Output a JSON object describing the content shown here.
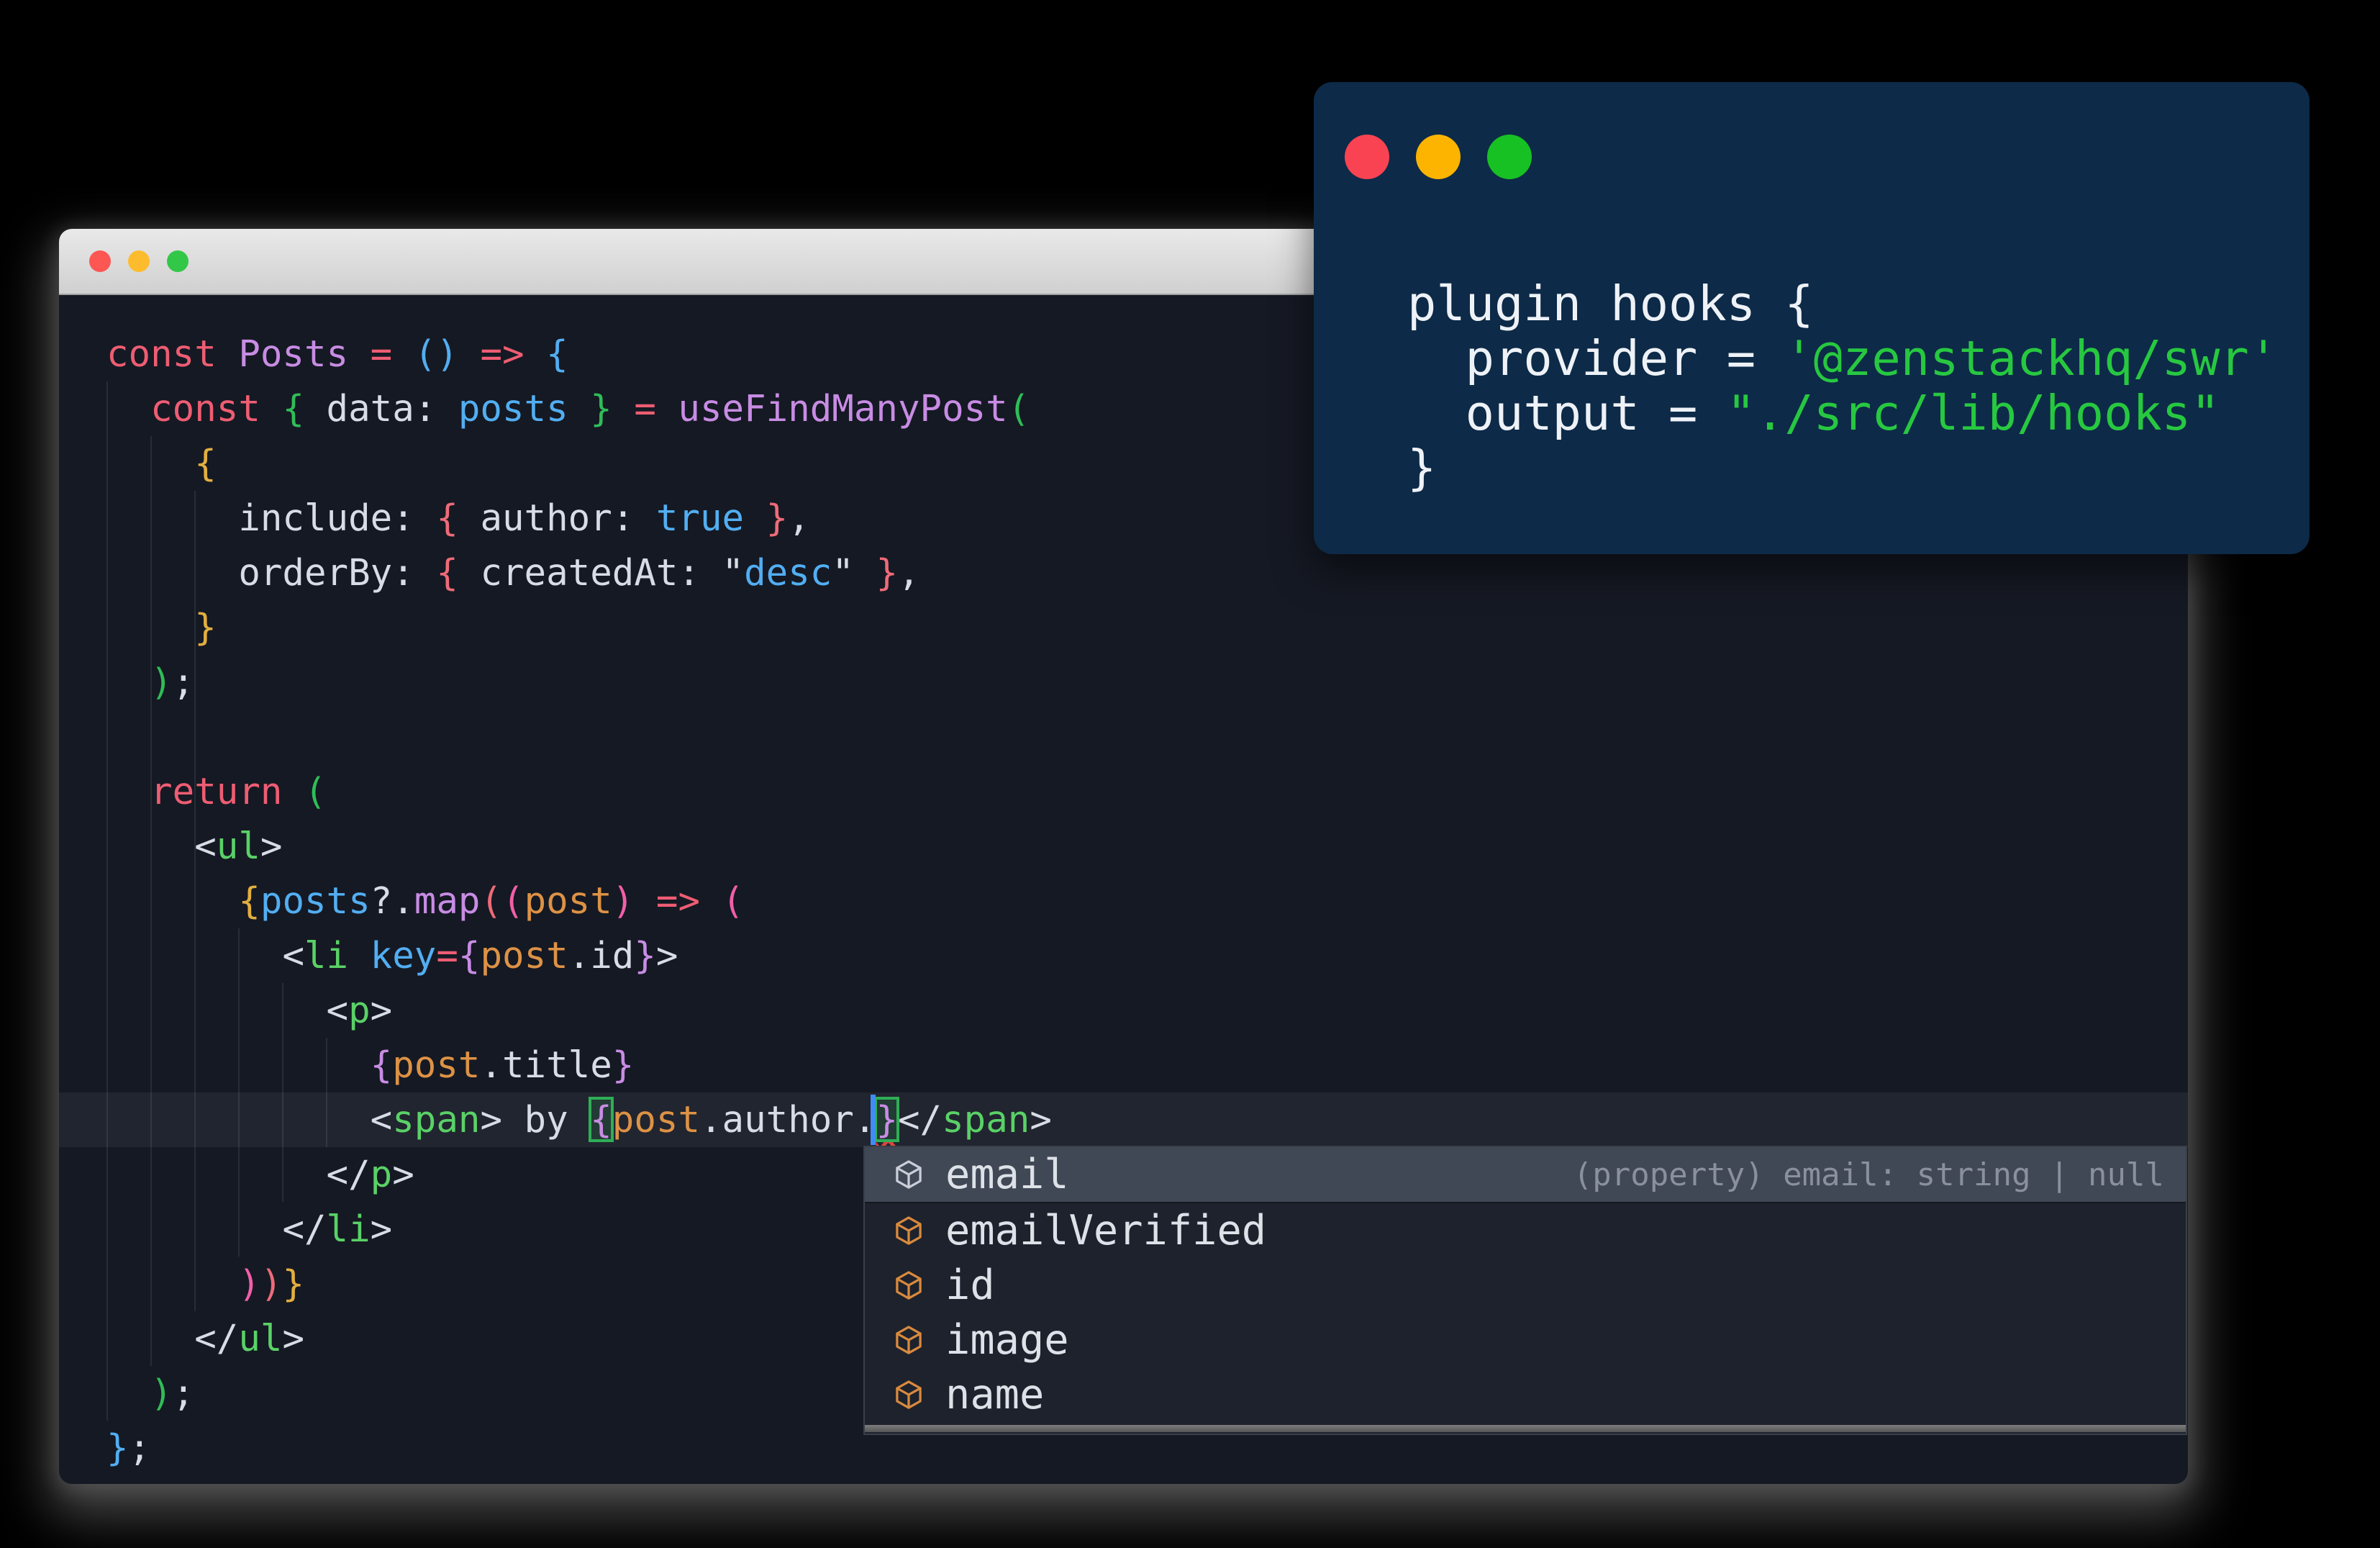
{
  "palette": {
    "fg": "#d7dce5",
    "red": "#ee5d73",
    "salmon": "#ee6b78",
    "purple": "#c88ce4",
    "blue": "#52aef2",
    "green_bracket": "#2fbd57",
    "green_tag": "#5ad167",
    "yellow": "#e2ae3f",
    "pink": "#f25fa9",
    "orange": "#dd9245",
    "editor_bg": "#151923",
    "overlay_bg": "#0d2a48",
    "overlay_fg": "#eef2f7",
    "overlay_green": "#27c840",
    "cursor_blue": "#3f8cf5",
    "squiggle_red": "#e0443f",
    "bracket_match_green": "#2fae56"
  },
  "main_window": {
    "traffic_lights": [
      {
        "name": "close",
        "color": "#fc5753"
      },
      {
        "name": "minimize",
        "color": "#fdbc2e"
      },
      {
        "name": "zoom",
        "color": "#33c748"
      }
    ]
  },
  "editor": {
    "current_line": 14,
    "lines": [
      [
        {
          "t": "const ",
          "c": "red"
        },
        {
          "t": "Posts ",
          "c": "purple"
        },
        {
          "t": "= ",
          "c": "red"
        },
        {
          "t": "()",
          "c": "blue"
        },
        {
          "t": " ",
          "c": "fg"
        },
        {
          "t": "=> ",
          "c": "red"
        },
        {
          "t": "{",
          "c": "blue"
        }
      ],
      [
        {
          "t": "  ",
          "c": "fg"
        },
        {
          "t": "const ",
          "c": "red"
        },
        {
          "t": "{ ",
          "c": "green_bracket"
        },
        {
          "t": "data: ",
          "c": "fg"
        },
        {
          "t": "posts ",
          "c": "blue"
        },
        {
          "t": "} ",
          "c": "green_bracket"
        },
        {
          "t": "= ",
          "c": "red"
        },
        {
          "t": "useFindManyPost",
          "c": "purple"
        },
        {
          "t": "(",
          "c": "green_bracket"
        }
      ],
      [
        {
          "t": "    ",
          "c": "fg"
        },
        {
          "t": "{",
          "c": "yellow"
        }
      ],
      [
        {
          "t": "      ",
          "c": "fg"
        },
        {
          "t": "include: ",
          "c": "fg"
        },
        {
          "t": "{ ",
          "c": "salmon"
        },
        {
          "t": "author: ",
          "c": "fg"
        },
        {
          "t": "true",
          "c": "blue"
        },
        {
          "t": " }",
          "c": "salmon"
        },
        {
          "t": ",",
          "c": "fg"
        }
      ],
      [
        {
          "t": "      ",
          "c": "fg"
        },
        {
          "t": "orderBy: ",
          "c": "fg"
        },
        {
          "t": "{ ",
          "c": "salmon"
        },
        {
          "t": "createdAt: ",
          "c": "fg"
        },
        {
          "t": "\"",
          "c": "fg"
        },
        {
          "t": "desc",
          "c": "blue"
        },
        {
          "t": "\"",
          "c": "fg"
        },
        {
          "t": " }",
          "c": "salmon"
        },
        {
          "t": ",",
          "c": "fg"
        }
      ],
      [
        {
          "t": "    ",
          "c": "fg"
        },
        {
          "t": "}",
          "c": "yellow"
        }
      ],
      [
        {
          "t": "  ",
          "c": "fg"
        },
        {
          "t": ")",
          "c": "green_bracket"
        },
        {
          "t": ";",
          "c": "fg"
        }
      ],
      [],
      [
        {
          "t": "  ",
          "c": "fg"
        },
        {
          "t": "return ",
          "c": "red"
        },
        {
          "t": "(",
          "c": "green_bracket"
        }
      ],
      [
        {
          "t": "    ",
          "c": "fg"
        },
        {
          "t": "<",
          "c": "fg"
        },
        {
          "t": "ul",
          "c": "green_tag"
        },
        {
          "t": ">",
          "c": "fg"
        }
      ],
      [
        {
          "t": "      ",
          "c": "fg"
        },
        {
          "t": "{",
          "c": "yellow"
        },
        {
          "t": "posts",
          "c": "blue"
        },
        {
          "t": "?.",
          "c": "fg"
        },
        {
          "t": "map",
          "c": "purple"
        },
        {
          "t": "(",
          "c": "salmon"
        },
        {
          "t": "(",
          "c": "pink"
        },
        {
          "t": "post",
          "c": "orange"
        },
        {
          "t": ")",
          "c": "pink"
        },
        {
          "t": " ",
          "c": "fg"
        },
        {
          "t": "=> ",
          "c": "red"
        },
        {
          "t": "(",
          "c": "pink"
        }
      ],
      [
        {
          "t": "        ",
          "c": "fg"
        },
        {
          "t": "<",
          "c": "fg"
        },
        {
          "t": "li",
          "c": "green_tag"
        },
        {
          "t": " ",
          "c": "fg"
        },
        {
          "t": "key",
          "c": "blue"
        },
        {
          "t": "=",
          "c": "red"
        },
        {
          "t": "{",
          "c": "purple"
        },
        {
          "t": "post",
          "c": "orange"
        },
        {
          "t": ".",
          "c": "fg"
        },
        {
          "t": "id",
          "c": "fg"
        },
        {
          "t": "}",
          "c": "purple"
        },
        {
          "t": ">",
          "c": "fg"
        }
      ],
      [
        {
          "t": "          ",
          "c": "fg"
        },
        {
          "t": "<",
          "c": "fg"
        },
        {
          "t": "p",
          "c": "green_tag"
        },
        {
          "t": ">",
          "c": "fg"
        }
      ],
      [
        {
          "t": "            ",
          "c": "fg"
        },
        {
          "t": "{",
          "c": "purple"
        },
        {
          "t": "post",
          "c": "orange"
        },
        {
          "t": ".title",
          "c": "fg"
        },
        {
          "t": "}",
          "c": "purple"
        }
      ],
      [
        {
          "t": "            ",
          "c": "fg"
        },
        {
          "t": "<",
          "c": "fg"
        },
        {
          "t": "span",
          "c": "green_tag"
        },
        {
          "t": "> ",
          "c": "fg"
        },
        {
          "t": "by ",
          "c": "fg"
        },
        {
          "t": "{",
          "c": "purple",
          "box": true
        },
        {
          "t": "post",
          "c": "orange"
        },
        {
          "t": ".author.",
          "c": "fg"
        },
        {
          "t": "}",
          "c": "purple",
          "box": true,
          "caret": true,
          "squiggle": true
        },
        {
          "t": "</",
          "c": "fg"
        },
        {
          "t": "span",
          "c": "green_tag"
        },
        {
          "t": ">",
          "c": "fg"
        }
      ],
      [
        {
          "t": "          ",
          "c": "fg"
        },
        {
          "t": "</",
          "c": "fg"
        },
        {
          "t": "p",
          "c": "green_tag"
        },
        {
          "t": ">",
          "c": "fg"
        }
      ],
      [
        {
          "t": "        ",
          "c": "fg"
        },
        {
          "t": "</",
          "c": "fg"
        },
        {
          "t": "li",
          "c": "green_tag"
        },
        {
          "t": ">",
          "c": "fg"
        }
      ],
      [
        {
          "t": "      ",
          "c": "fg"
        },
        {
          "t": ")",
          "c": "pink"
        },
        {
          "t": ")",
          "c": "salmon"
        },
        {
          "t": "}",
          "c": "yellow"
        }
      ],
      [
        {
          "t": "    ",
          "c": "fg"
        },
        {
          "t": "</",
          "c": "fg"
        },
        {
          "t": "ul",
          "c": "green_tag"
        },
        {
          "t": ">",
          "c": "fg"
        }
      ],
      [
        {
          "t": "  ",
          "c": "fg"
        },
        {
          "t": ")",
          "c": "green_bracket"
        },
        {
          "t": ";",
          "c": "fg"
        }
      ],
      [
        {
          "t": "}",
          "c": "blue"
        },
        {
          "t": ";",
          "c": "fg"
        }
      ]
    ]
  },
  "suggest": {
    "items": [
      {
        "label": "email",
        "selected": true,
        "detail": "(property) email: string | null"
      },
      {
        "label": "emailVerified"
      },
      {
        "label": "id"
      },
      {
        "label": "image"
      },
      {
        "label": "name"
      }
    ]
  },
  "overlay_window": {
    "traffic_lights": [
      {
        "name": "close",
        "color": "#f94352"
      },
      {
        "name": "minimize",
        "color": "#fcb400"
      },
      {
        "name": "zoom",
        "color": "#17c123"
      }
    ],
    "lines": [
      [
        {
          "t": "plugin hooks {",
          "c": "overlay_fg"
        }
      ],
      [
        {
          "t": "  provider = ",
          "c": "overlay_fg"
        },
        {
          "t": "'@zenstackhq/swr'",
          "c": "overlay_green"
        }
      ],
      [
        {
          "t": "  output = ",
          "c": "overlay_fg"
        },
        {
          "t": "\"./src/lib/hooks\"",
          "c": "overlay_green"
        }
      ],
      [
        {
          "t": "}",
          "c": "overlay_fg"
        }
      ]
    ]
  }
}
